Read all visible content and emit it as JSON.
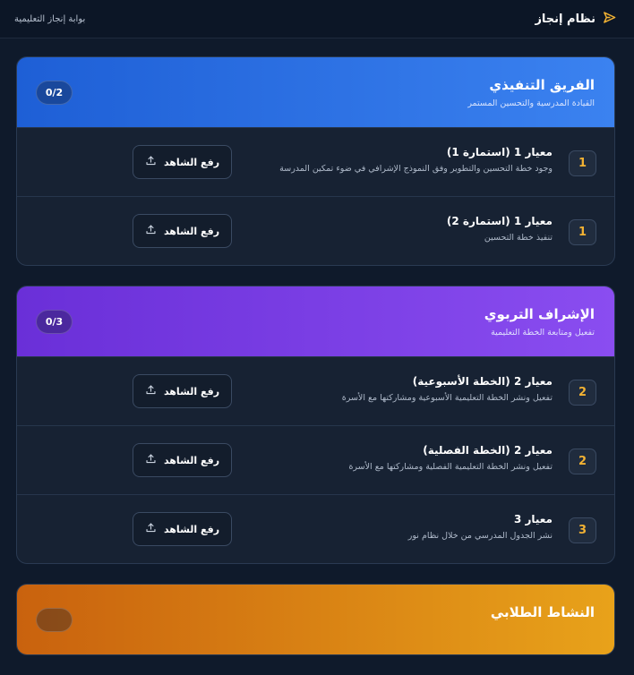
{
  "app": {
    "brand_name": "نظام إنجاز",
    "portal_name": "بوابة إنجاز التعليمية",
    "brand_icon": "send-icon",
    "accent_color": "#f2b233"
  },
  "upload_label": "رفع الشاهد",
  "sections": [
    {
      "title": "الفريق التنفيذي",
      "subtitle": "القيادة المدرسية والتحسين المستمر",
      "count": "0/2",
      "color_from": "#1e5fd6",
      "color_to": "#3b82f0",
      "items": [
        {
          "num": "1",
          "title": "معيار 1 (استمارة 1)",
          "desc": "وجود خطة التحسين والتطوير وفق النموذج الإشرافي في ضوء تمكين المدرسة"
        },
        {
          "num": "1",
          "title": "معيار 1 (استمارة 2)",
          "desc": "تنفيذ خطة التحسين"
        }
      ]
    },
    {
      "title": "الإشراف التربوي",
      "subtitle": "تفعيل ومتابعة الخطة التعليمية",
      "count": "0/3",
      "color_from": "#6a2fd8",
      "color_to": "#8a4df0",
      "items": [
        {
          "num": "2",
          "title": "معيار 2 (الخطة الأسبوعية)",
          "desc": "تفعيل ونشر الخطة التعليمية الأسبوعية ومشاركتها مع الأسرة"
        },
        {
          "num": "2",
          "title": "معيار 2 (الخطة الفصلية)",
          "desc": "تفعيل ونشر الخطة التعليمية الفصلية ومشاركتها مع الأسرة"
        },
        {
          "num": "3",
          "title": "معيار 3",
          "desc": "نشر الجدول المدرسي من خلال نظام نور"
        }
      ]
    },
    {
      "title": "النشاط الطلابي",
      "color_from": "#c9620e",
      "color_to": "#e8a21a"
    }
  ]
}
